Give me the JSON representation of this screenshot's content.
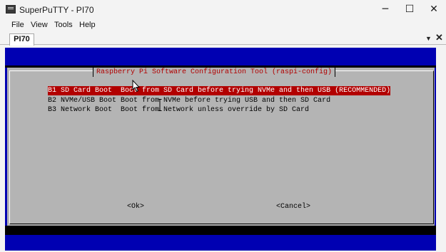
{
  "window": {
    "title": "SuperPuTTY - PI70",
    "controls": {
      "minimize": "─",
      "maximize": "☐",
      "close": "✕"
    }
  },
  "menu": [
    "File",
    "View",
    "Tools",
    "Help"
  ],
  "tabs": [
    {
      "label": "PI70",
      "active": true
    }
  ],
  "tab_controls": {
    "dropdown": "▼",
    "close": "✕"
  },
  "dialog": {
    "title": "Raspberry Pi Software Configuration Tool (raspi-config)",
    "options": [
      {
        "text": "B1 SD Card Boot  Boot from SD Card before trying NVMe and then USB (RECOMMENDED)",
        "selected": true
      },
      {
        "text": "B2 NVMe/USB Boot Boot from NVMe before trying USB and then SD Card",
        "selected": false
      },
      {
        "text": "B3 Network Boot  Boot from Network unless override by SD Card",
        "selected": false
      }
    ],
    "ok_label": "<Ok>",
    "cancel_label": "<Cancel>"
  },
  "colors": {
    "terminal_bg": "#0000b2",
    "dialog_bg": "#b4b4b4",
    "highlight": "#b20000",
    "title_text": "#b20000"
  },
  "icons": {
    "app": "terminal-icon",
    "cursor": "mouse-pointer-icon",
    "text_cursor": "text-ibeam-icon"
  }
}
